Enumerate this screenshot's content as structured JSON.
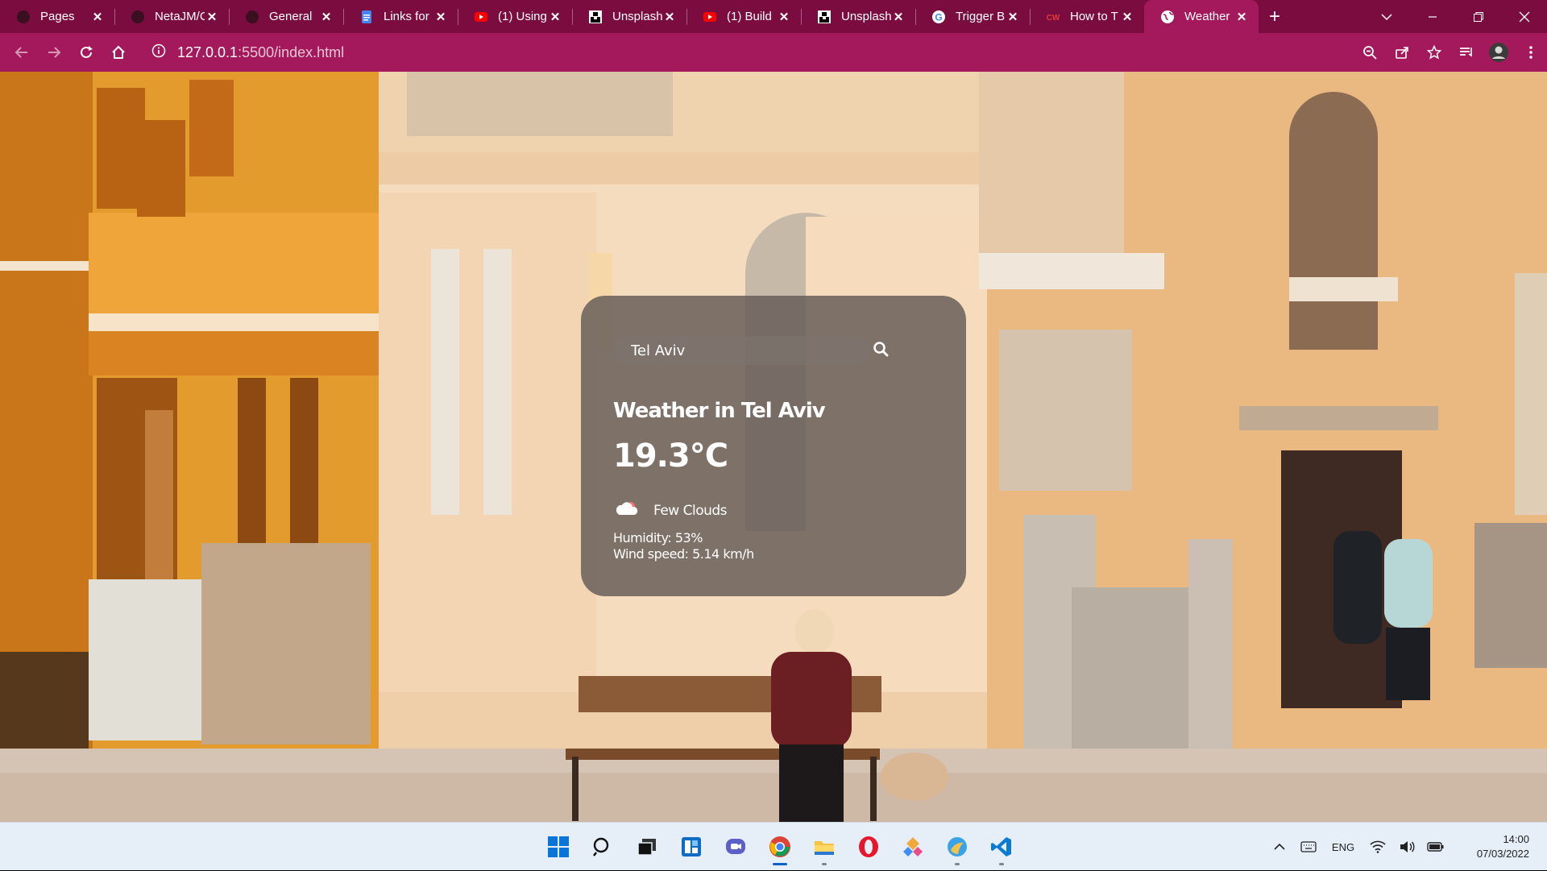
{
  "browser": {
    "tabs": [
      {
        "label": "Pages",
        "icon": "github-icon"
      },
      {
        "label": "NetaJM/C",
        "icon": "github-icon"
      },
      {
        "label": "General",
        "icon": "github-icon"
      },
      {
        "label": "Links for",
        "icon": "google-docs-icon"
      },
      {
        "label": "(1) Using",
        "icon": "youtube-icon"
      },
      {
        "label": "Unsplash",
        "icon": "unsplash-icon"
      },
      {
        "label": "(1) Build",
        "icon": "youtube-icon"
      },
      {
        "label": "Unsplash",
        "icon": "unsplash-icon"
      },
      {
        "label": "Trigger B",
        "icon": "google-icon"
      },
      {
        "label": "How to T",
        "icon": "codewars-icon"
      },
      {
        "label": "Weather",
        "icon": "globe-icon",
        "active": true
      }
    ],
    "new_tab_label": "+",
    "url_host": "127.0.0.1",
    "url_rest": ":5500/index.html",
    "colors": {
      "tabbar": "#7b0c3f",
      "toolbar": "#a4195b"
    }
  },
  "weather": {
    "search_value": "Tel Aviv",
    "city_heading": "Weather in Tel Aviv",
    "temperature": "19.3°C",
    "description": "Few Clouds",
    "humidity": "Humidity: 53%",
    "wind": "Wind speed: 5.14 km/h"
  },
  "taskbar": {
    "apps": [
      "windows-start-icon",
      "search-icon",
      "task-view-icon",
      "widgets-icon",
      "teams-chat-icon",
      "chrome-icon",
      "file-explorer-icon",
      "opera-icon",
      "git-kraken-icon",
      "photo-app-icon",
      "vscode-icon"
    ],
    "language": "ENG",
    "time": "14:00",
    "date": "07/03/2022"
  }
}
